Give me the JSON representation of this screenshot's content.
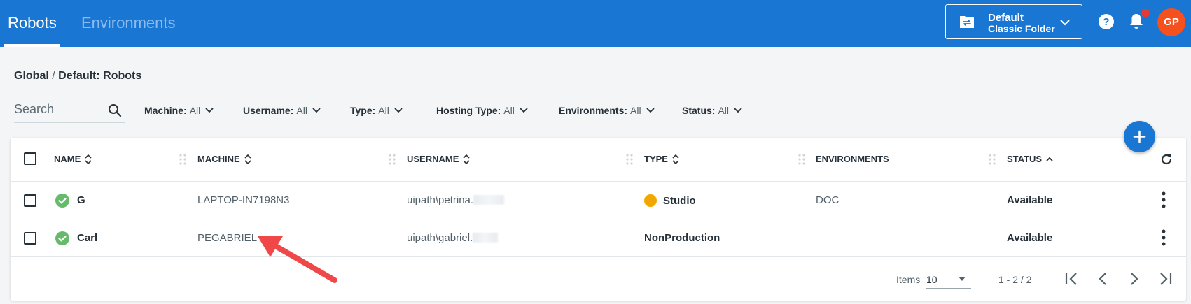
{
  "header": {
    "tabs": [
      {
        "label": "Robots",
        "active": true
      },
      {
        "label": "Environments",
        "active": false
      }
    ],
    "folder": {
      "name": "Default",
      "subtitle": "Classic Folder"
    },
    "avatar_initials": "GP",
    "accent_color": "#1976d2"
  },
  "breadcrumb": {
    "root": "Global",
    "separator": "/",
    "current": "Default: Robots"
  },
  "search": {
    "placeholder": "Search",
    "value": ""
  },
  "filters": [
    {
      "label": "Machine:",
      "value": "All"
    },
    {
      "label": "Username:",
      "value": "All"
    },
    {
      "label": "Type:",
      "value": "All"
    },
    {
      "label": "Hosting Type:",
      "value": "All"
    },
    {
      "label": "Environments:",
      "value": "All"
    },
    {
      "label": "Status:",
      "value": "All"
    }
  ],
  "table": {
    "columns": [
      "NAME",
      "MACHINE",
      "USERNAME",
      "TYPE",
      "ENVIRONMENTS",
      "STATUS"
    ],
    "rows": [
      {
        "name": "G",
        "machine": "LAPTOP-IN7198N3",
        "username": "uipath\\petrina.",
        "type": "Studio",
        "environments": "DOC",
        "status": "Available"
      },
      {
        "name": "Carl",
        "machine": "PEGABRIEL",
        "username": "uipath\\gabriel.",
        "type": "NonProduction",
        "environments": "",
        "status": "Available"
      }
    ]
  },
  "pagination": {
    "items_label": "Items",
    "page_size": "10",
    "range": "1 - 2 / 2"
  },
  "icons": {
    "folder": "folder-switch-icon",
    "help": "help-circle-icon",
    "notifications": "bell-icon",
    "add": "plus-icon",
    "refresh": "refresh-icon",
    "row_status": "check-circle-icon",
    "row_menu": "kebab-menu-icon"
  },
  "colors": {
    "status_ok": "#66bb6a",
    "studio_type": "#f0a800",
    "notification_dot": "#e53935",
    "avatar": "#f4511e",
    "annotation_arrow": "#f04848"
  }
}
